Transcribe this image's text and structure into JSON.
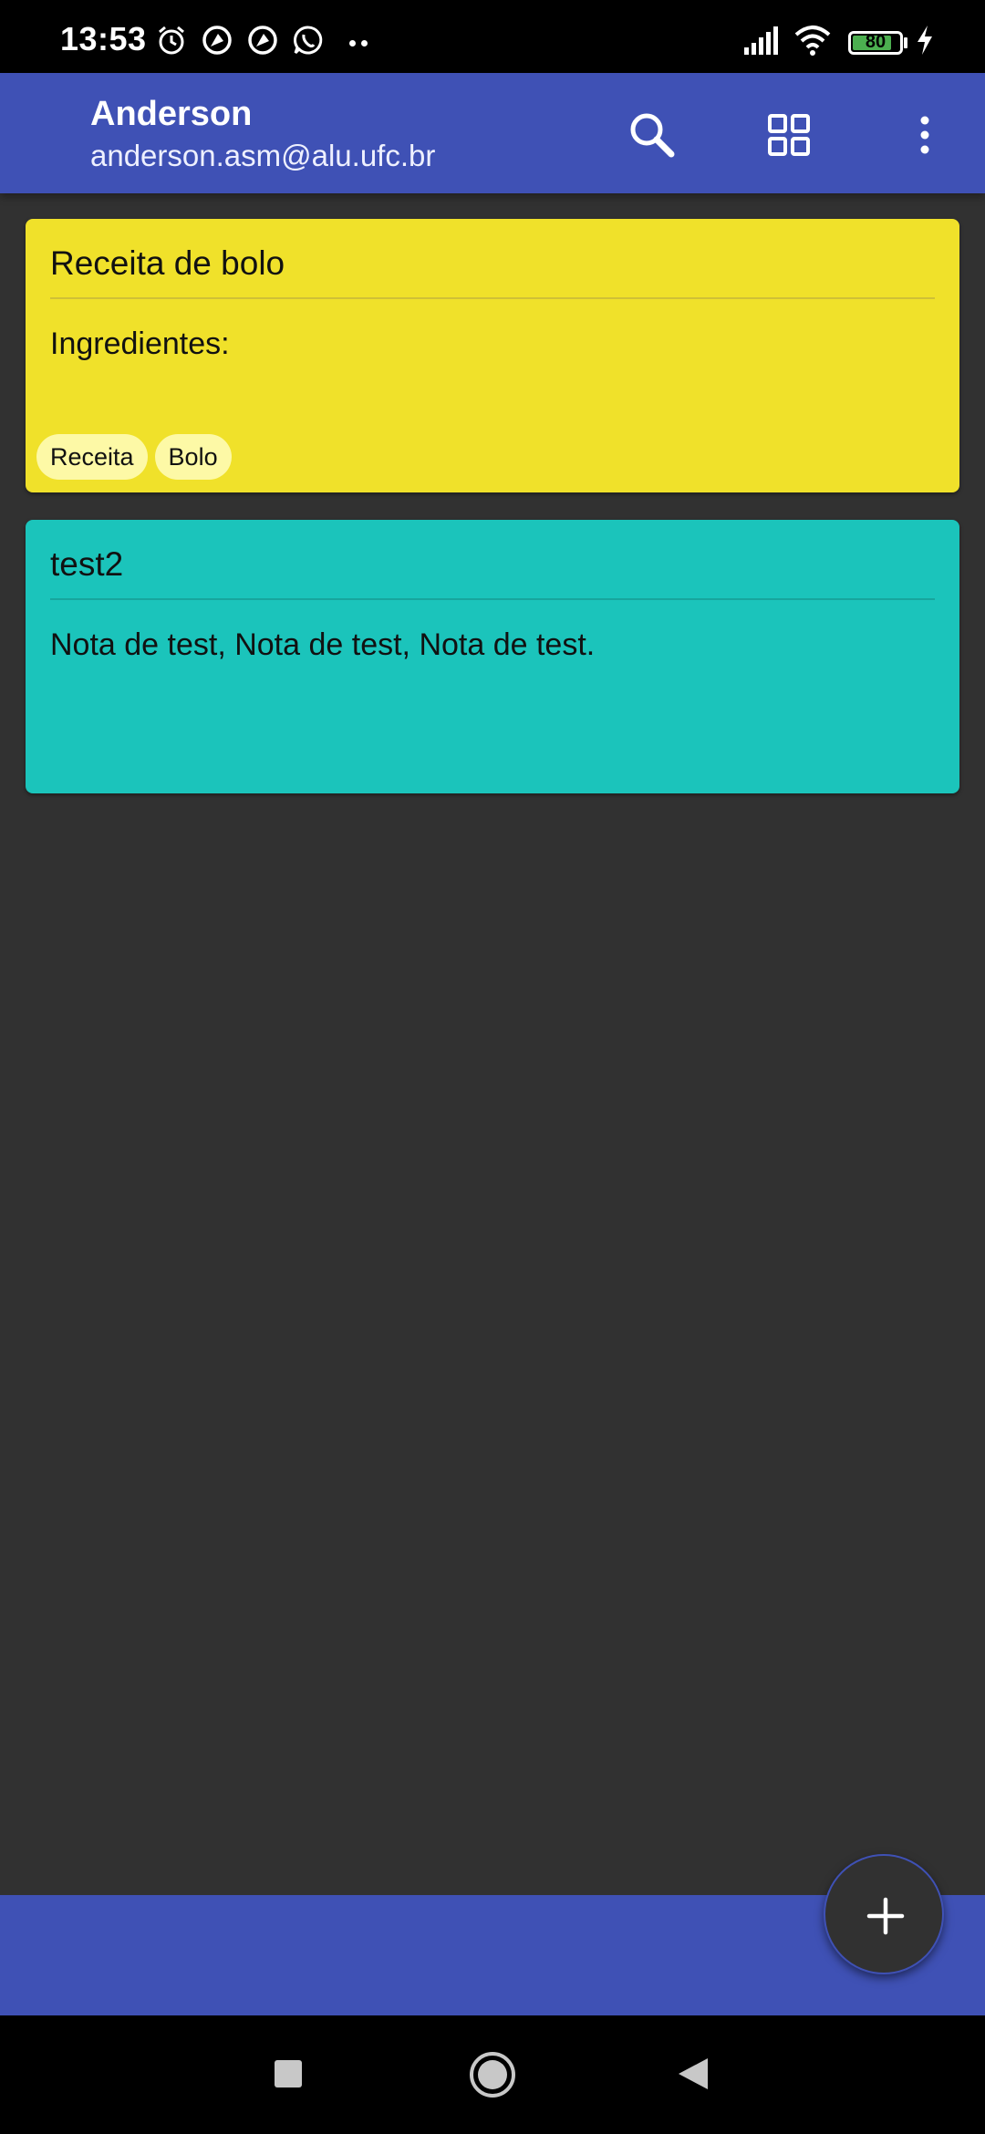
{
  "status_bar": {
    "time": "13:53",
    "battery_level": "80",
    "icons": [
      "alarm-icon",
      "app-notification-icon",
      "app-notification-icon",
      "whatsapp-icon",
      "more-notifications-icon",
      "signal-icon",
      "wifi-icon",
      "battery-icon",
      "charging-icon"
    ]
  },
  "appbar": {
    "user_name": "Anderson",
    "user_email": "anderson.asm@alu.ufc.br",
    "actions": [
      "search-icon",
      "grid-view-icon",
      "more-vert-icon"
    ]
  },
  "notes": [
    {
      "title": "Receita de bolo",
      "body": "Ingredientes:",
      "color": "#f0e12a",
      "divider_color": "#cfc036",
      "tags": [
        "Receita",
        "Bolo"
      ]
    },
    {
      "title": "test2",
      "body": "Nota de test, Nota de test, Nota de test.",
      "color": "#1bc4bb",
      "divider_color": "#17a59d",
      "tags": []
    }
  ],
  "colors": {
    "primary": "#3f51b5",
    "background": "#313131"
  },
  "fab": {
    "icon": "plus-icon"
  },
  "nav_bar": [
    "recents-icon",
    "home-icon",
    "back-icon"
  ]
}
